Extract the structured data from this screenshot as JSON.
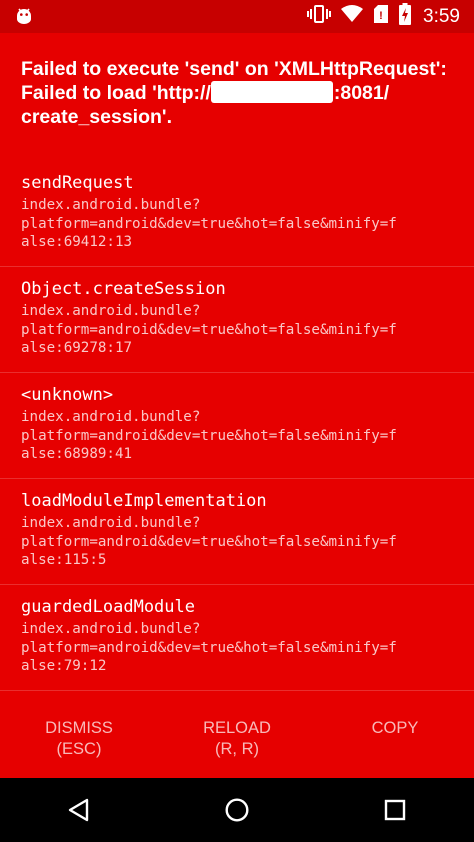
{
  "status_bar": {
    "time": "3:59",
    "icons": [
      "android-debug-icon",
      "vibrate-icon",
      "wifi-icon",
      "no-sim-icon",
      "battery-charging-icon"
    ]
  },
  "error": {
    "title_line1": "Failed to execute 'send' on 'XMLHttpRequest':",
    "title_line2_prefix": "Failed to load 'http://",
    "title_line2_suffix": ":8081/",
    "title_line3": "create_session'."
  },
  "stack": [
    {
      "method": "sendRequest",
      "file": "index.android.bundle?\nplatform=android&dev=true&hot=false&minify=f\nalse:69412:13"
    },
    {
      "method": "Object.createSession",
      "file": "index.android.bundle?\nplatform=android&dev=true&hot=false&minify=f\nalse:69278:17"
    },
    {
      "method": "<unknown>",
      "file": "index.android.bundle?\nplatform=android&dev=true&hot=false&minify=f\nalse:68989:41"
    },
    {
      "method": "loadModuleImplementation",
      "file": "index.android.bundle?\nplatform=android&dev=true&hot=false&minify=f\nalse:115:5"
    },
    {
      "method": "guardedLoadModule",
      "file": "index.android.bundle?\nplatform=android&dev=true&hot=false&minify=f\nalse:79:12"
    }
  ],
  "buttons": {
    "dismiss_line1": "DISMISS",
    "dismiss_line2": "(ESC)",
    "reload_line1": "RELOAD",
    "reload_line2": "(R, R)",
    "copy": "COPY"
  },
  "colors": {
    "redbox": "#e60000",
    "status_bar": "#c70000",
    "nav_bar": "#000000"
  }
}
